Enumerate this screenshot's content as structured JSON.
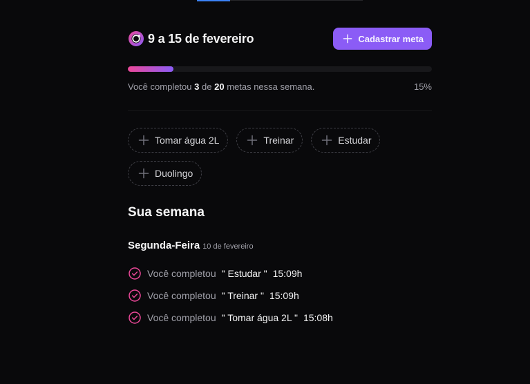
{
  "header": {
    "logo_icon": "in-orbit-logo-icon",
    "week_label": "9 a 15 de fevereiro",
    "create_button_label": "Cadastrar meta",
    "create_button_icon": "plus-icon"
  },
  "progress": {
    "completed": "3",
    "total": "20",
    "percent_label": "15%",
    "fraction": 0.15,
    "text_prefix": "Você completou",
    "text_of": "de",
    "text_suffix": "metas nessa semana."
  },
  "pending_goals": [
    {
      "label": "Tomar água 2L"
    },
    {
      "label": "Treinar"
    },
    {
      "label": "Estudar"
    },
    {
      "label": "Duolingo"
    }
  ],
  "summary": {
    "title": "Sua semana",
    "days": [
      {
        "name": "Segunda-Feira",
        "date": "10 de fevereiro",
        "entries": [
          {
            "prefix": "Você completou",
            "goal": "\" Estudar \"",
            "time": "15:09h"
          },
          {
            "prefix": "Você completou",
            "goal": "\" Treinar \"",
            "time": "15:09h"
          },
          {
            "prefix": "Você completou",
            "goal": "\" Tomar água 2L \"",
            "time": "15:08h"
          }
        ]
      }
    ]
  },
  "colors": {
    "background": "#09090b",
    "accent": "#8b5cf6",
    "accent_secondary": "#ec4899"
  }
}
